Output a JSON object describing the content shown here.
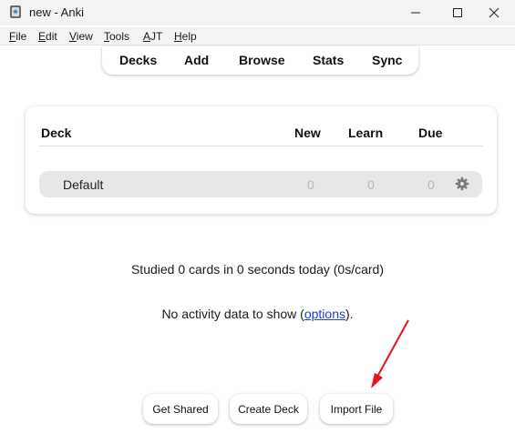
{
  "window": {
    "title": "new - Anki"
  },
  "menubar": {
    "items": [
      "File",
      "Edit",
      "View",
      "Tools",
      "AJT",
      "Help"
    ]
  },
  "toolbar": {
    "links": [
      "Decks",
      "Add",
      "Browse",
      "Stats",
      "Sync"
    ]
  },
  "deck_list": {
    "headers": {
      "deck": "Deck",
      "new": "New",
      "learn": "Learn",
      "due": "Due"
    },
    "rows": [
      {
        "name": "Default",
        "new": "0",
        "learn": "0",
        "due": "0"
      }
    ]
  },
  "stats": {
    "studied": "Studied 0 cards in 0 seconds today (0s/card)",
    "activity_prefix": "No activity data to show (",
    "activity_link": "options",
    "activity_suffix": ")."
  },
  "buttons": {
    "get_shared": "Get Shared",
    "create_deck": "Create Deck",
    "import_file": "Import File"
  },
  "colors": {
    "annotation_arrow": "#e0141e",
    "link": "#1a3fd1"
  },
  "icons": {
    "app": "anki-icon",
    "deck_options": "gear-icon"
  }
}
